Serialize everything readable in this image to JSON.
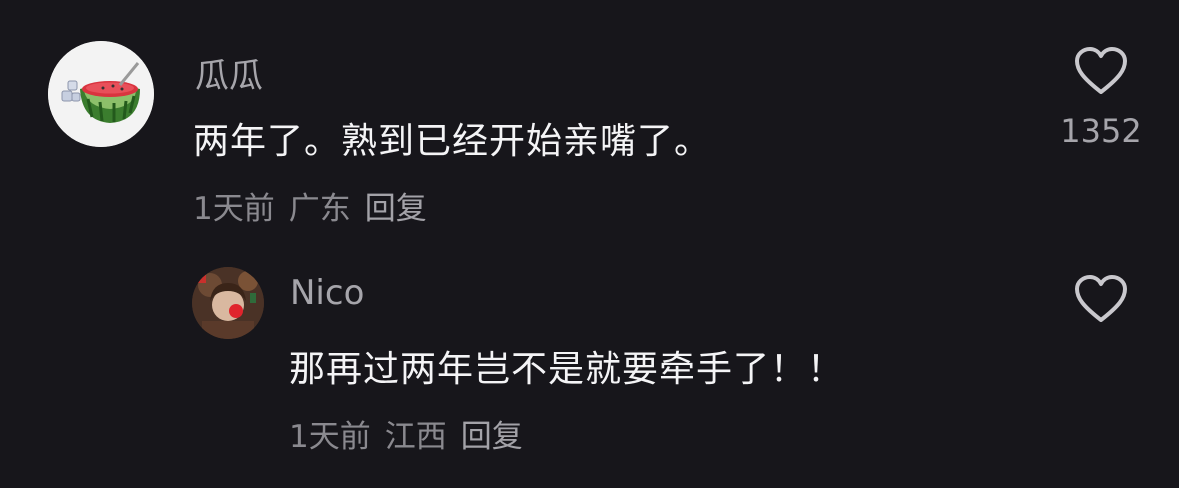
{
  "comments": [
    {
      "username": "瓜瓜",
      "text": "两年了。熟到已经开始亲嘴了。",
      "time": "1天前",
      "location": "广东",
      "reply_label": "回复",
      "likes": "1352",
      "avatar": "watermelon-avatar"
    },
    {
      "username": "Nico",
      "text": "那再过两年岂不是就要牵手了！！",
      "time": "1天前",
      "location": "江西",
      "reply_label": "回复",
      "avatar": "girl-avatar"
    }
  ],
  "icons": {
    "like": "heart-outline-icon"
  },
  "colors": {
    "background": "#17161b",
    "text": "#f4f4f6",
    "secondary": "#a6a5ab",
    "meta": "#8a898f"
  }
}
